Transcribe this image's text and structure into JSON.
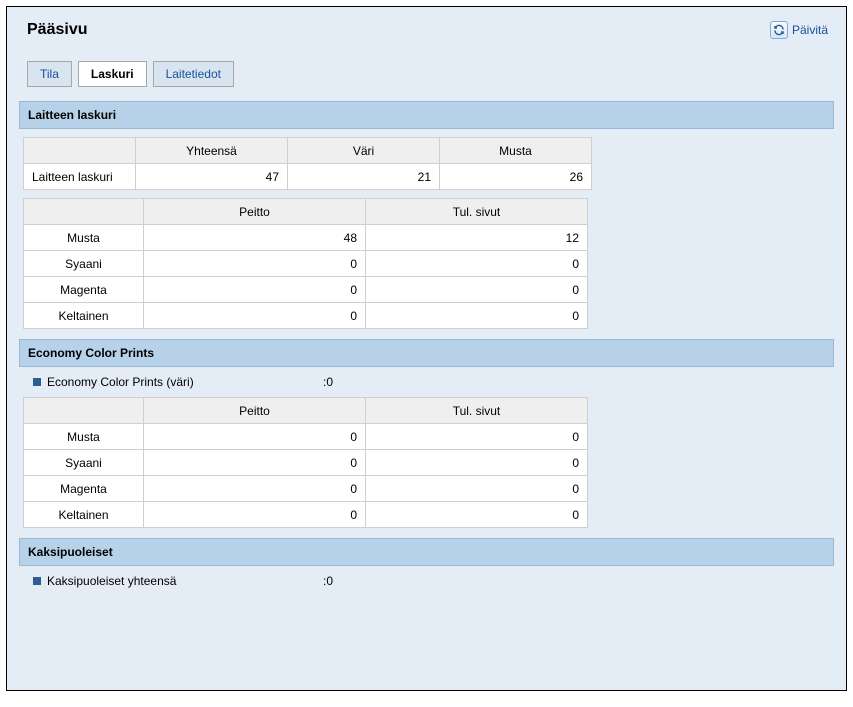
{
  "page_title": "Pääsivu",
  "refresh_label": "Päivitä",
  "tabs": {
    "tila": "Tila",
    "laskuri": "Laskuri",
    "laitetiedot": "Laitetiedot"
  },
  "section1": {
    "title": "Laitteen laskuri",
    "headers": {
      "total": "Yhteensä",
      "color": "Väri",
      "black": "Musta"
    },
    "row_label": "Laitteen laskuri",
    "values": {
      "total": "47",
      "color": "21",
      "black": "26"
    }
  },
  "coverage_headers": {
    "coverage": "Peitto",
    "pages": "Tul. sivut"
  },
  "colors": {
    "black": "Musta",
    "cyan": "Syaani",
    "magenta": "Magenta",
    "yellow": "Keltainen"
  },
  "coverage1": {
    "black": {
      "cov": "48",
      "pages": "12"
    },
    "cyan": {
      "cov": "0",
      "pages": "0"
    },
    "magenta": {
      "cov": "0",
      "pages": "0"
    },
    "yellow": {
      "cov": "0",
      "pages": "0"
    }
  },
  "section2": {
    "title": "Economy Color Prints",
    "info_label": "Economy Color Prints (väri)",
    "info_value": ":0"
  },
  "coverage2": {
    "black": {
      "cov": "0",
      "pages": "0"
    },
    "cyan": {
      "cov": "0",
      "pages": "0"
    },
    "magenta": {
      "cov": "0",
      "pages": "0"
    },
    "yellow": {
      "cov": "0",
      "pages": "0"
    }
  },
  "section3": {
    "title": "Kaksipuoleiset",
    "info_label": "Kaksipuoleiset yhteensä",
    "info_value": ":0"
  }
}
